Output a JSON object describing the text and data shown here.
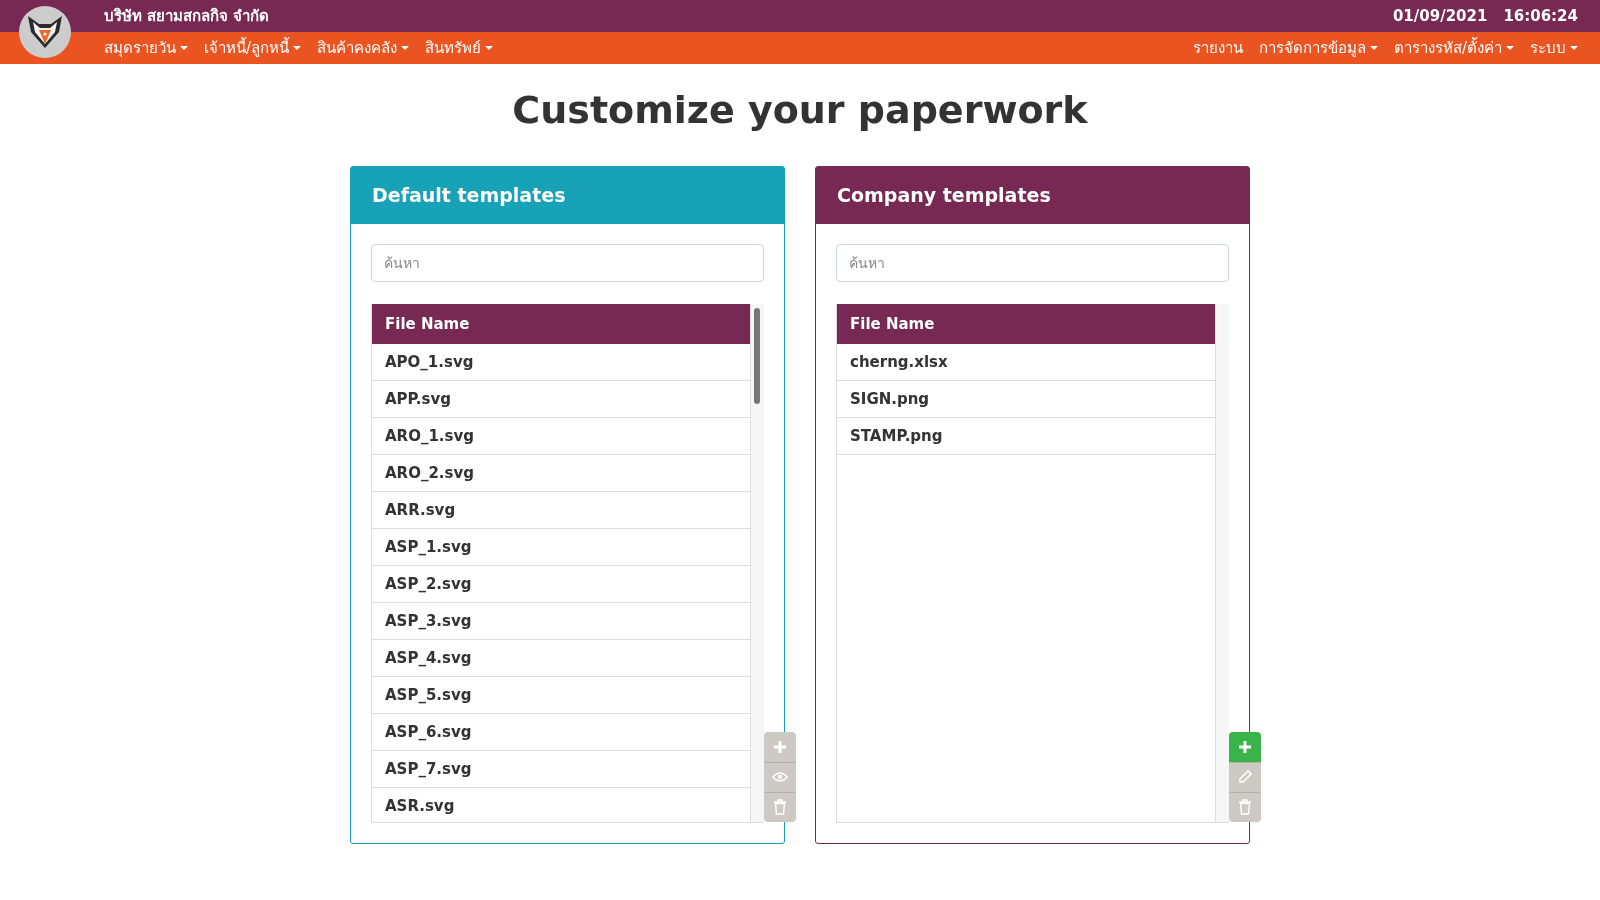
{
  "header": {
    "company": "บริษัท สยามสกลกิจ จำกัด",
    "date": "01/09/2021",
    "time": "16:06:24"
  },
  "menu_left": [
    {
      "label": "สมุดรายวัน",
      "dropdown": true
    },
    {
      "label": "เจ้าหนี้/ลูกหนี้",
      "dropdown": true
    },
    {
      "label": "สินค้าคงคลัง",
      "dropdown": true
    },
    {
      "label": "สินทรัพย์",
      "dropdown": true
    }
  ],
  "menu_right": [
    {
      "label": "รายงาน",
      "dropdown": false
    },
    {
      "label": "การจัดการข้อมูล",
      "dropdown": true
    },
    {
      "label": "ตารางรหัส/ตั้งค่า",
      "dropdown": true
    },
    {
      "label": "ระบบ",
      "dropdown": true
    }
  ],
  "page_title": "Customize your paperwork",
  "panels": [
    {
      "title": "Default templates",
      "color": "#17a2b8",
      "search": {
        "placeholder": "ค้นหา"
      },
      "column": "File Name",
      "scrollbar": true,
      "rows": [
        "APO_1.svg",
        "APP.svg",
        "ARO_1.svg",
        "ARO_2.svg",
        "ARR.svg",
        "ASP_1.svg",
        "ASP_2.svg",
        "ASP_3.svg",
        "ASP_4.svg",
        "ASP_5.svg",
        "ASP_6.svg",
        "ASP_7.svg",
        "ASR.svg"
      ],
      "actions": [
        {
          "kind": "add",
          "disabled": true
        },
        {
          "kind": "view",
          "disabled": true
        },
        {
          "kind": "delete",
          "disabled": true
        }
      ]
    },
    {
      "title": "Company templates",
      "color": "#772953",
      "search": {
        "placeholder": "ค้นหา"
      },
      "column": "File Name",
      "scrollbar": false,
      "rows": [
        "cherng.xlsx",
        "SIGN.png",
        "STAMP.png"
      ],
      "actions": [
        {
          "kind": "add",
          "disabled": false
        },
        {
          "kind": "edit",
          "disabled": true
        },
        {
          "kind": "delete",
          "disabled": true
        }
      ]
    }
  ]
}
